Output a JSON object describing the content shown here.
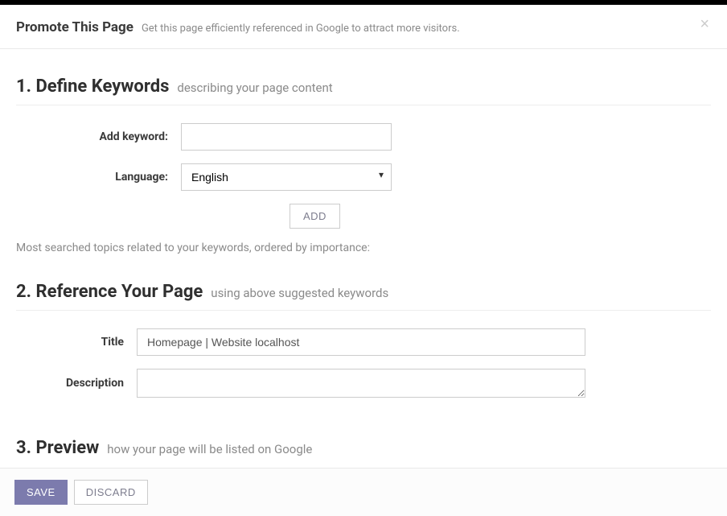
{
  "header": {
    "title": "Promote This Page",
    "subtitle": "Get this page efficiently referenced in Google to attract more visitors."
  },
  "section1": {
    "title": "1. Define Keywords",
    "desc": "describing your page content",
    "keyword_label": "Add keyword:",
    "keyword_value": "",
    "language_label": "Language:",
    "language_value": "English",
    "add_btn": "ADD",
    "help_text": "Most searched topics related to your keywords, ordered by importance:"
  },
  "section2": {
    "title": "2. Reference Your Page",
    "desc": "using above suggested keywords",
    "title_label": "Title",
    "title_value": "Homepage | Website localhost",
    "description_label": "Description",
    "description_value": ""
  },
  "section3": {
    "title": "3. Preview",
    "desc": "how your page will be listed on Google"
  },
  "footer": {
    "save": "SAVE",
    "discard": "DISCARD"
  }
}
